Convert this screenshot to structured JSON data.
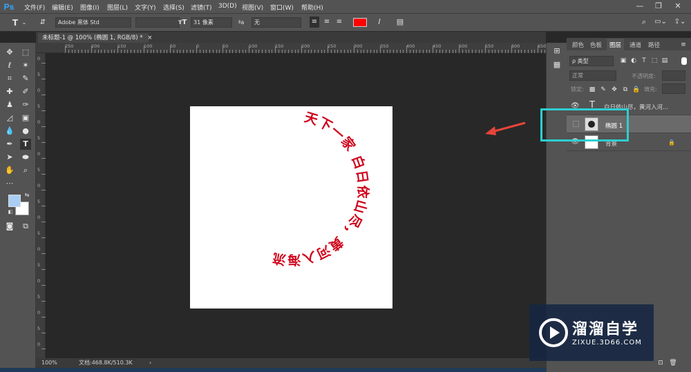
{
  "app": {
    "logo": "Ps"
  },
  "menu": [
    "文件(F)",
    "编辑(E)",
    "图像(I)",
    "图层(L)",
    "文字(Y)",
    "选择(S)",
    "滤镜(T)",
    "3D(D)",
    "视图(V)",
    "窗口(W)",
    "帮助(H)"
  ],
  "window_controls": {
    "minimize": "—",
    "restore": "❐",
    "close": "✕"
  },
  "options": {
    "tool_glyph": "T",
    "font_family": "Adobe 黑体 Std",
    "font_size": "31 像素",
    "aa_label": "ªa",
    "antialias": "无",
    "text_color": "#ff0000"
  },
  "document": {
    "tab_title": "未标题-1 @ 100% (椭圆 1, RGB/8) *",
    "tab_close": "×",
    "zoom": "100%",
    "doc_info": "文档:468.8K/510.3K",
    "status_arrow": "›",
    "circle_text": "天下一家 白日依山尽，黄河入海流",
    "text_color": "#d0021b"
  },
  "rulers": {
    "horizontal": [
      "250",
      "200",
      "150",
      "100",
      "50",
      "0",
      "50",
      "100",
      "150",
      "200",
      "250",
      "300",
      "350",
      "400",
      "450",
      "500",
      "550",
      "600",
      "650"
    ],
    "vertical": [
      "0",
      "5",
      "0",
      "5",
      "0",
      "5",
      "0",
      "5",
      "0",
      "5",
      "0",
      "5",
      "0",
      "5",
      "0",
      "5",
      "0",
      "5",
      "0"
    ]
  },
  "panel": {
    "tabs": [
      "颜色",
      "色板",
      "图层",
      "通道",
      "路径"
    ],
    "active_tab": "图层",
    "filter_label": "ρ 类型",
    "blend_mode": "正常",
    "opacity_label": "不透明度:",
    "lock_label": "锁定:",
    "fill_label": "填充:",
    "layers": [
      {
        "name": "白日依山尽，黄河入河...",
        "type": "text"
      },
      {
        "name": "椭圆 1",
        "type": "shape",
        "selected": true
      },
      {
        "name": "背景",
        "type": "background",
        "locked": true
      }
    ]
  },
  "watermark": {
    "title": "溜溜自学",
    "url": "ZIXUE.3D66.COM"
  },
  "colors": {
    "foreground": "#a9cdf3",
    "background": "#ffffff",
    "highlight": "#2dcfd1",
    "arrow": "#e8443a"
  }
}
